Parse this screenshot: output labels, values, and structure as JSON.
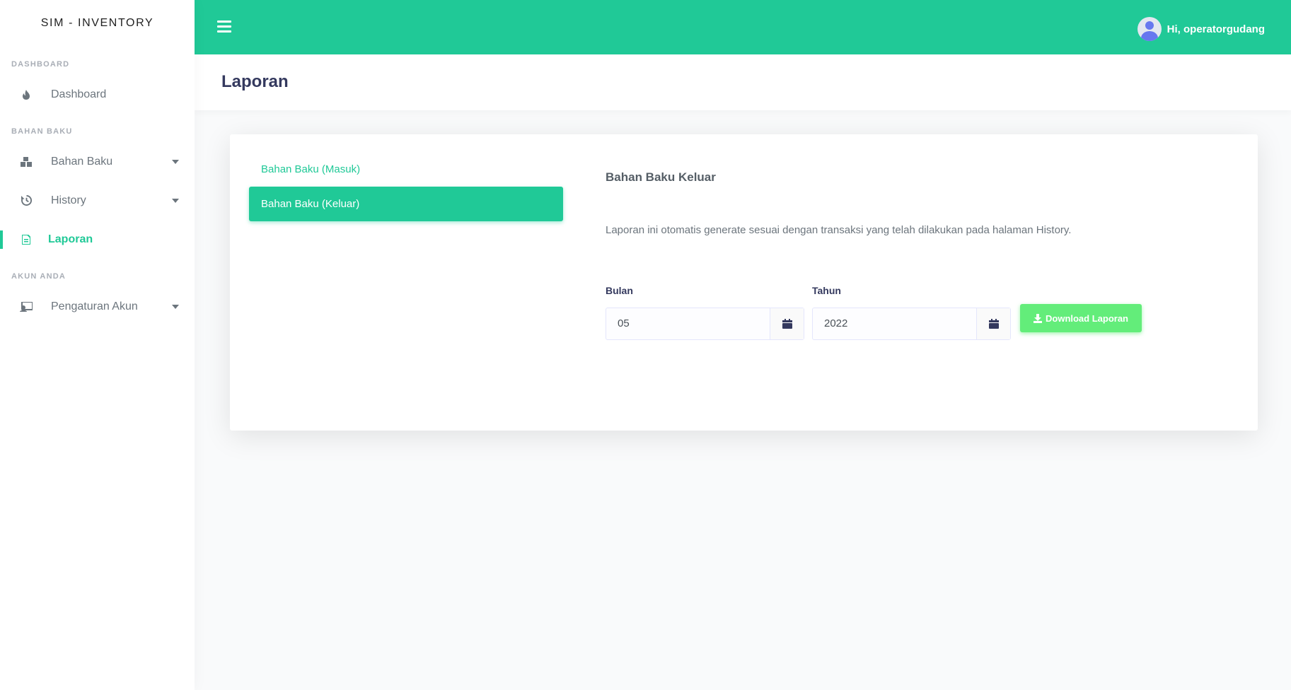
{
  "brand": "SIM - INVENTORY",
  "sidebar": {
    "sections": [
      {
        "header": "DASHBOARD",
        "items": [
          {
            "label": "Dashboard",
            "icon": "fire-icon",
            "has_caret": false,
            "active": false
          }
        ]
      },
      {
        "header": "BAHAN BAKU",
        "items": [
          {
            "label": "Bahan Baku",
            "icon": "boxes-icon",
            "has_caret": true,
            "active": false
          },
          {
            "label": "History",
            "icon": "history-icon",
            "has_caret": true,
            "active": false
          },
          {
            "label": "Laporan",
            "icon": "file-icon",
            "has_caret": false,
            "active": true
          }
        ]
      },
      {
        "header": "AKUN ANDA",
        "items": [
          {
            "label": "Pengaturan Akun",
            "icon": "user-settings-icon",
            "has_caret": true,
            "active": false
          }
        ]
      }
    ]
  },
  "topbar": {
    "menu_icon": "hamburger-icon",
    "user_greeting": "Hi, operatorgudang"
  },
  "page": {
    "title": "Laporan"
  },
  "tabs": [
    {
      "label": "Bahan Baku (Masuk)",
      "active": false
    },
    {
      "label": "Bahan Baku (Keluar)",
      "active": true
    }
  ],
  "content": {
    "title": "Bahan Baku Keluar",
    "description": "Laporan ini otomatis generate sesuai dengan transaksi yang telah dilakukan pada halaman History.",
    "bulan": {
      "label": "Bulan",
      "value": "05"
    },
    "tahun": {
      "label": "Tahun",
      "value": "2022"
    },
    "download_label": "Download Laporan"
  },
  "colors": {
    "primary": "#20c997",
    "success": "#63ed7a",
    "text": "#34395e",
    "muted": "#6c757d"
  }
}
